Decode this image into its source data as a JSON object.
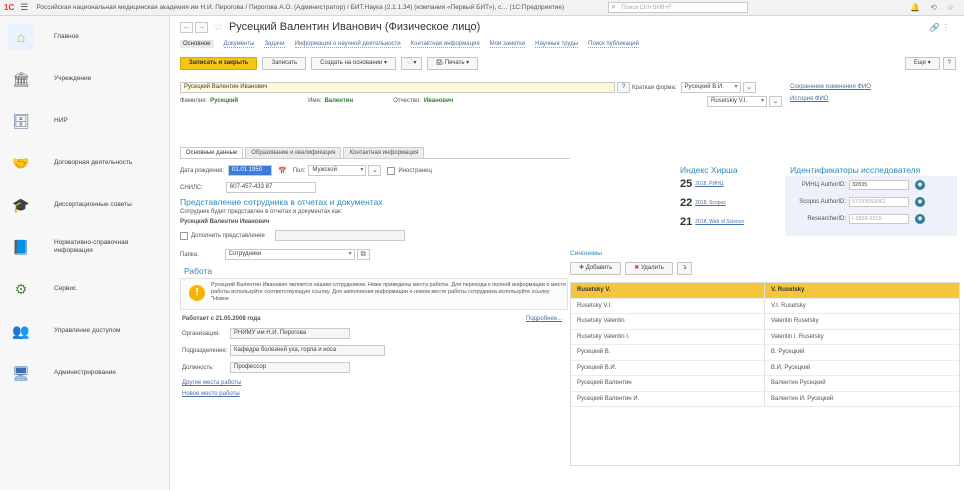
{
  "app": {
    "logo": "1С",
    "title": "Российская национальная медицинская академия им Н.И. Пирогова / Пирогова А.О. (Администратор) / БИТ.Наука (2.1.1.34) (компания «Первый БИТ»), с… (1С:Предприятие)",
    "search_placeholder": "Поиск Ctrl+Shift+F"
  },
  "sidebar": {
    "items": [
      {
        "label": "Главное",
        "icon": "home-icon"
      },
      {
        "label": "Учреждение",
        "icon": "building-icon"
      },
      {
        "label": "НИР",
        "icon": "database-icon"
      },
      {
        "label": "Договорная деятельность",
        "icon": "handshake-icon"
      },
      {
        "label": "Диссертационные советы",
        "icon": "graduation-icon"
      },
      {
        "label": "Нормативно-справочная информация",
        "icon": "book-icon"
      },
      {
        "label": "Сервис",
        "icon": "tools-icon"
      },
      {
        "label": "Управление доступом",
        "icon": "users-icon"
      },
      {
        "label": "Администрирование",
        "icon": "admin-icon"
      }
    ]
  },
  "header": {
    "title": "Русецкий Валентин Иванович (Физическое лицо)"
  },
  "nav_links": [
    "Основное",
    "Документы",
    "Задачи",
    "Информация о научной деятельности",
    "Контактная информация",
    "Мои заметки",
    "Научные труды",
    "Поиск публикаций"
  ],
  "toolbar": {
    "save_close": "Записать и закрыть",
    "save": "Записать",
    "create_based": "Создать на основании",
    "print": "Печать",
    "more": "Еще"
  },
  "form": {
    "fullname": "Русецкий Валентин Иванович",
    "surname_label": "Фамилия:",
    "surname": "Русецкий",
    "name_label": "Имя:",
    "name": "Валентин",
    "patronymic_label": "Отчество:",
    "patronymic": "Иванович",
    "short_form_label": "Краткая форма:",
    "short_form_ru": "Русецкий В.И.",
    "short_form_en": "Rusetskiy V.I.",
    "history_link": "Сохранение изменения ФИО",
    "history_link2": "История ФИО"
  },
  "tabs": [
    "Основные данные",
    "Образование и квалификация",
    "Контактная информация"
  ],
  "basic": {
    "birth_label": "Дата рождения:",
    "birth": "01.01.1950",
    "sex_label": "Пол:",
    "sex": "Мужской",
    "foreigner_label": "Иностранец",
    "snils_label": "СНИЛС:",
    "snils": "607-457-433 87"
  },
  "representation": {
    "title": "Представление сотрудника в отчетах и документах",
    "desc": "Сотрудник будет представлен в отчетах и документах как:",
    "value": "Русецкий Валентин Иванович",
    "extend_label": "Дополнить представление",
    "folder_label": "Папка:",
    "folder": "Сотрудники"
  },
  "work": {
    "title": "Работа",
    "info": "Русецкий Валентин Иванович является нашим сотрудником. Ниже приведены места работы. Для перехода к полной информации о месте работы используйте соответствующую ссылку. Для заполнения информации о новом месте работы сотрудника используйте ссылку \"Новое",
    "since": "Работает с 21.05.2008 года",
    "details_link": "Подробнее...",
    "org_label": "Организация:",
    "org": "РНИМУ им Н.И. Пирогова",
    "dept_label": "Подразделение:",
    "dept": "Кафедра болезней уха, горла и носа",
    "position_label": "Должность:",
    "position": "Профессор",
    "other_link": "Другие места работы",
    "new_link": "Новое место работы"
  },
  "hirsch": {
    "title": "Индекс Хирша",
    "items": [
      {
        "value": "25",
        "source": "2018, РИНЦ"
      },
      {
        "value": "22",
        "source": "2018, Scopus"
      },
      {
        "value": "21",
        "source": "2018, Web of Science"
      }
    ]
  },
  "identifiers": {
    "title": "Идентификаторы исследователя",
    "items": [
      {
        "label": "РИНЦ AuthorID:",
        "value": "32835"
      },
      {
        "label": "Scopus AuthorID:",
        "value": "57193053062"
      },
      {
        "label": "ResearcherID:",
        "value": "I-2893-2015"
      }
    ]
  },
  "synonyms": {
    "title": "Синонимы",
    "add": "Добавить",
    "delete": "Удалить",
    "rows": [
      [
        "Rusetsky V.",
        "V. Rusetsky"
      ],
      [
        "Rusetsky V.I.",
        "V.I. Rusetsky"
      ],
      [
        "Rusetsky Valentin",
        "Valentin Rusetsky"
      ],
      [
        "Rusetsky Valentin I.",
        "Valentin I. Rusetsky"
      ],
      [
        "Русецкий В.",
        "В. Русецкий"
      ],
      [
        "Русецкий В.И.",
        "В.И. Русецкий"
      ],
      [
        "Русецкий Валентин",
        "Валентин Русецкий"
      ],
      [
        "Русецкий Валентин И.",
        "Валентин И. Русецкий"
      ]
    ]
  },
  "colors": {
    "accent": "#f5c518",
    "link": "#4a6fa5",
    "section": "#2f8ab5"
  }
}
